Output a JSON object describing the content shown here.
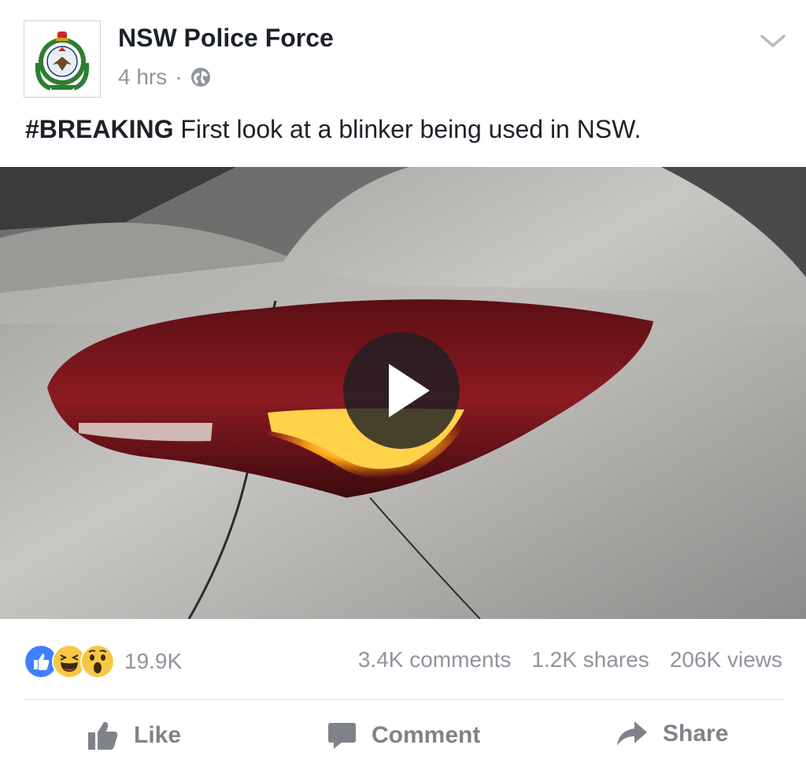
{
  "post": {
    "page_name": "NSW Police Force",
    "time": "4 hrs",
    "separator": "·",
    "audience_icon": "globe-icon",
    "caption_hashtag": "#BREAKING",
    "caption_text": " First look at a blinker being used in NSW."
  },
  "video": {
    "play_icon": "play-icon"
  },
  "stats": {
    "reaction_icons": [
      "like-reaction-icon",
      "haha-reaction-icon",
      "wow-reaction-icon"
    ],
    "reaction_count": "19.9K",
    "comments": "3.4K comments",
    "shares": "1.2K shares",
    "views": "206K views"
  },
  "actions": {
    "like": "Like",
    "comment": "Comment",
    "share": "Share"
  },
  "colors": {
    "text_primary": "#1d2129",
    "text_secondary": "#90949c",
    "like_blue": "#4080ff",
    "reaction_yellow": "#f7c744",
    "action_gray": "#7f8389"
  }
}
